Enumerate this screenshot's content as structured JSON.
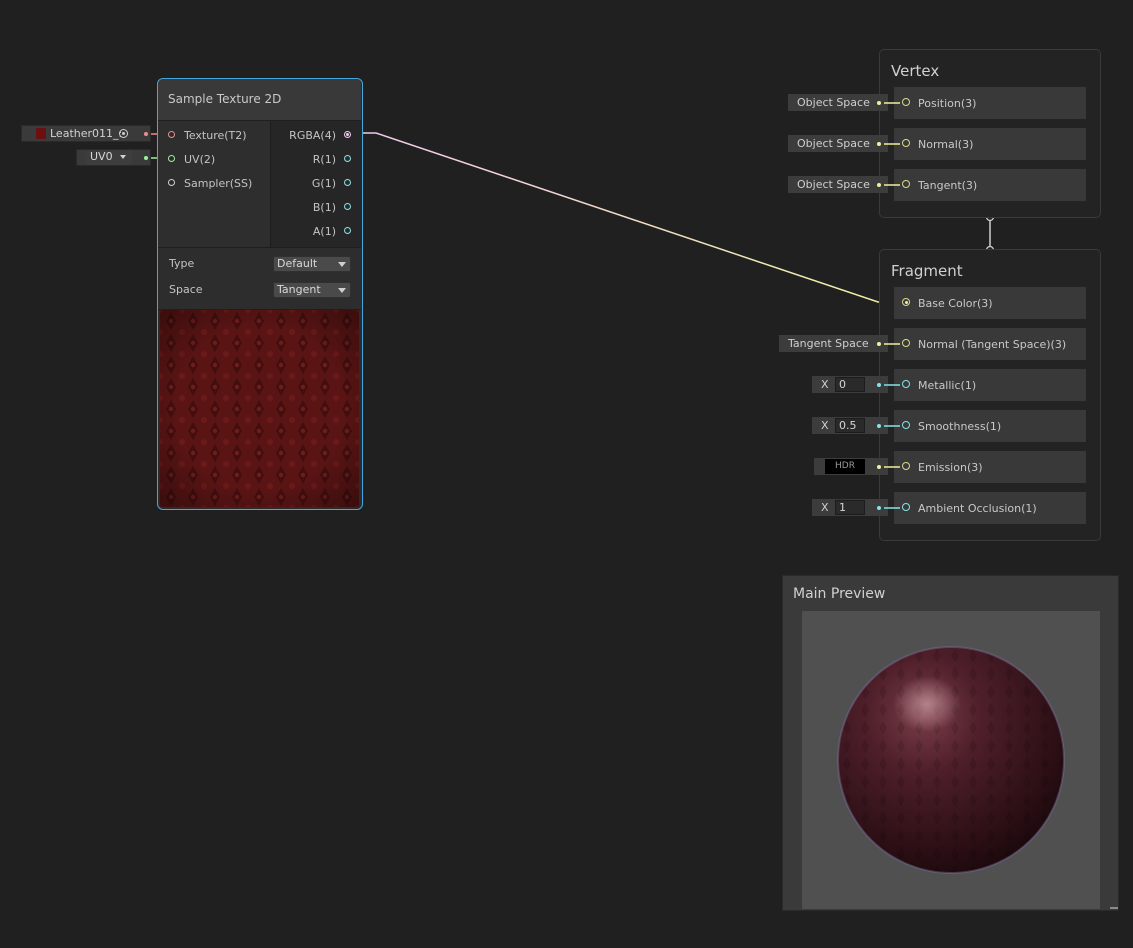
{
  "sample_node": {
    "title": "Sample Texture 2D",
    "inputs": [
      "Texture(T2)",
      "UV(2)",
      "Sampler(SS)"
    ],
    "outputs": [
      "RGBA(4)",
      "R(1)",
      "G(1)",
      "B(1)",
      "A(1)"
    ],
    "texture_field": "Leather011_:",
    "uv_field": "UV0",
    "type_label": "Type",
    "type_value": "Default",
    "space_label": "Space",
    "space_value": "Tangent"
  },
  "vertex": {
    "title": "Vertex",
    "slots": [
      {
        "label": "Position(3)",
        "input": "Object Space"
      },
      {
        "label": "Normal(3)",
        "input": "Object Space"
      },
      {
        "label": "Tangent(3)",
        "input": "Object Space"
      }
    ]
  },
  "fragment": {
    "title": "Fragment",
    "slots": [
      {
        "label": "Base Color(3)"
      },
      {
        "label": "Normal (Tangent Space)(3)",
        "input": "Tangent Space"
      },
      {
        "label": "Metallic(1)",
        "input_axis": "X",
        "input_value": "0"
      },
      {
        "label": "Smoothness(1)",
        "input_axis": "X",
        "input_value": "0.5"
      },
      {
        "label": "Emission(3)",
        "input": "HDR"
      },
      {
        "label": "Ambient Occlusion(1)",
        "input_axis": "X",
        "input_value": "1"
      }
    ]
  },
  "preview": {
    "title": "Main Preview"
  },
  "colors": {
    "selection": "#44a8e0",
    "texture_port": "#f08c8c",
    "vector2_port": "#9df09d",
    "vector4_port": "#f0c8f0",
    "vector3_port": "#f0f09d",
    "float_port": "#84e4e7"
  }
}
